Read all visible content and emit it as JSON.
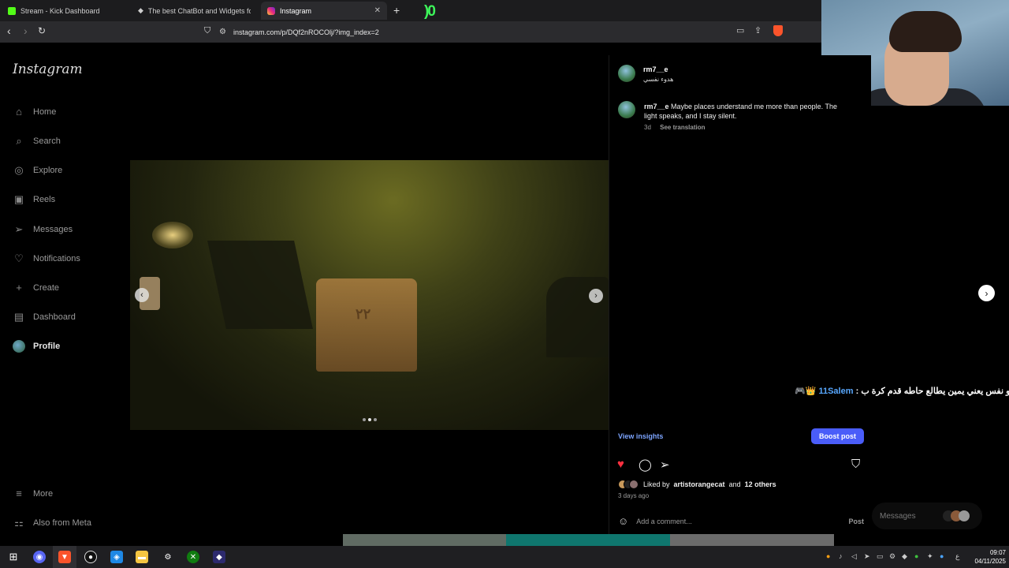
{
  "browser": {
    "tabs": [
      {
        "label": "Stream - Kick Dashboard",
        "favicon_color": "#53fc18",
        "active": false
      },
      {
        "label": "The best ChatBot and Widgets for Ki",
        "favicon_color": "#ffffff",
        "active": false
      },
      {
        "label": "Instagram",
        "favicon_color": "#e1306c",
        "active": true
      }
    ],
    "new_tab": "+",
    "overlay_glyph": ")0",
    "url": "instagram.com/p/DQf2nROCOlj/?img_index=2"
  },
  "sidebar": {
    "logo": "Instagram",
    "items": [
      {
        "label": "Home",
        "icon": "home-icon",
        "glyph": "⌂"
      },
      {
        "label": "Search",
        "icon": "search-icon",
        "glyph": "⌕"
      },
      {
        "label": "Explore",
        "icon": "compass-icon",
        "glyph": "◎"
      },
      {
        "label": "Reels",
        "icon": "reels-icon",
        "glyph": "▣"
      },
      {
        "label": "Messages",
        "icon": "send-icon",
        "glyph": "➢"
      },
      {
        "label": "Notifications",
        "icon": "heart-icon",
        "glyph": "♡"
      },
      {
        "label": "Create",
        "icon": "plus-icon",
        "glyph": "+"
      },
      {
        "label": "Dashboard",
        "icon": "dashboard-icon",
        "glyph": "▤"
      },
      {
        "label": "Profile",
        "icon": "avatar",
        "glyph": ""
      }
    ],
    "more": "More",
    "meta": "Also from Meta"
  },
  "post": {
    "username": "rm7__e",
    "subtitle": "هدوء نفسي",
    "caption_user": "rm7__e",
    "caption_text": "Maybe places understand me more than people. The light speaks, and I stay silent.",
    "caption_age": "3d",
    "see_translation": "See translation",
    "chair_number": "٢٢",
    "carousel_index": 2,
    "carousel_count": 3,
    "view_insights": "View insights",
    "boost_post": "Boost post",
    "liked_prefix": "Liked by",
    "liked_user": "artistorangecat",
    "liked_and": "and",
    "liked_others": "12 others",
    "posted_ago": "3 days ago",
    "comment_placeholder": "Add a comment...",
    "post_button": "Post",
    "like_color": "#ff3040"
  },
  "stream_overlay": {
    "badges": "🎮👑",
    "chat_name": "11Salem",
    "chat_separator": " : ",
    "chat_message": "عمرو نفس يعني يمين يطالع حاطه قدم كرة ب"
  },
  "messages_pill": {
    "label": "Messages"
  },
  "taskbar": {
    "time": "09:07",
    "date": "04/11/2025",
    "lang": "ع"
  }
}
